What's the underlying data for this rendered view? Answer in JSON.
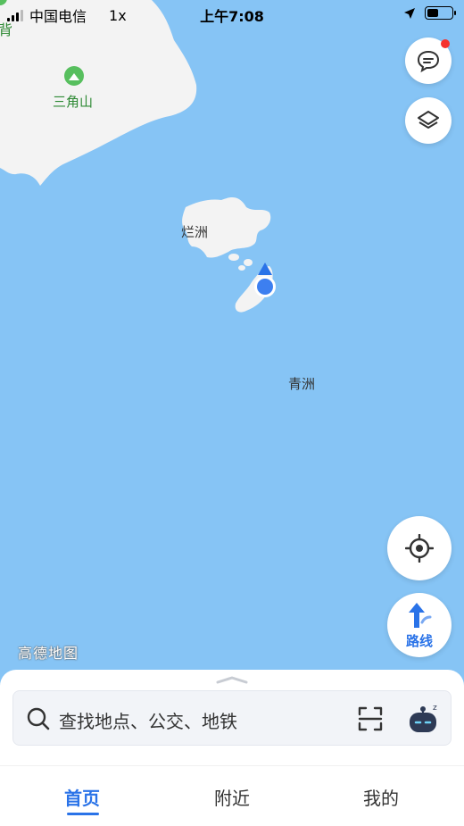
{
  "status_bar": {
    "carrier": "中国电信",
    "speed": "1x",
    "time": "上午7:08",
    "battery_level": 0.45
  },
  "map": {
    "poi": {
      "name": "三角山",
      "icon": "mountain-icon"
    },
    "corner_label": "背",
    "labels": {
      "island_1": "烂洲",
      "island_2": "青洲"
    },
    "watermark": "高德地图",
    "colors": {
      "water": "#86c4f5",
      "land": "#f3f3f3",
      "accent": "#2a73e8"
    }
  },
  "controls": {
    "message": {
      "icon": "message-icon",
      "has_notification": true
    },
    "layers": {
      "icon": "layers-icon"
    },
    "locate": {
      "icon": "locate-icon"
    },
    "route": {
      "label": "路线",
      "icon": "route-arrow-icon"
    }
  },
  "search": {
    "placeholder": "查找地点、公交、地铁",
    "icons": [
      "search-icon",
      "scan-icon",
      "assistant-icon"
    ]
  },
  "tabs": [
    {
      "label": "首页",
      "active": true
    },
    {
      "label": "附近",
      "active": false
    },
    {
      "label": "我的",
      "active": false
    }
  ]
}
